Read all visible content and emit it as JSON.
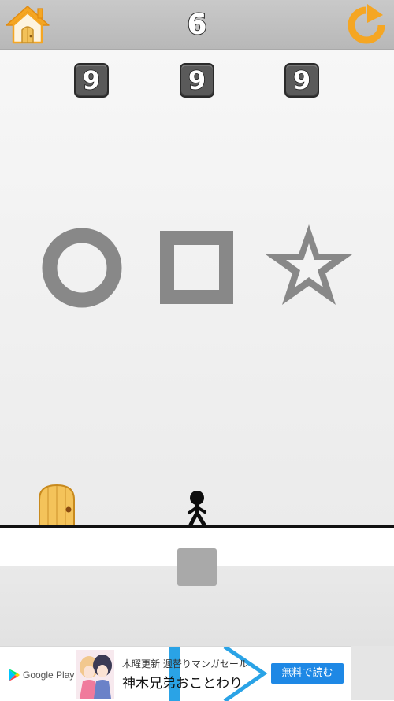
{
  "header": {
    "level": "6"
  },
  "puzzle": {
    "digits": [
      "9",
      "9",
      "9"
    ],
    "shapes": [
      "circle-icon",
      "square-icon",
      "star-icon"
    ],
    "shape_color": "#888888"
  },
  "scene": {
    "door": "door-icon",
    "player": "stickman-icon",
    "ground_color": "#111111"
  },
  "controls": {
    "action_button_color": "#a9a9a9"
  },
  "ad": {
    "store_label": "Google Play",
    "line1": "木曜更新 週替りマンガセール",
    "line2": "神木兄弟おことわり",
    "cta": "無料で読む",
    "cta_color": "#1e88e5"
  },
  "colors": {
    "accent_orange": "#f5a623",
    "topbar": "#bdbdbd"
  }
}
